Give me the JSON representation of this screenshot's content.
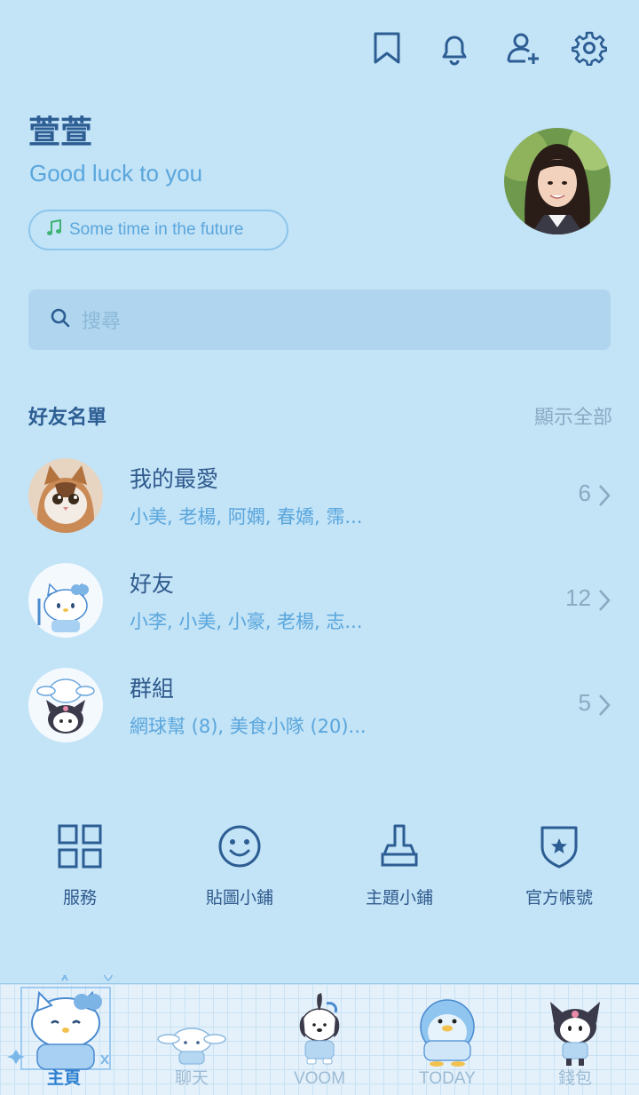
{
  "header": {
    "icons": [
      "bookmark-icon",
      "bell-icon",
      "add-friend-icon",
      "settings-gear-icon"
    ]
  },
  "profile": {
    "name": "萱萱",
    "status_message": "Good luck to you",
    "music": "Some time in the future"
  },
  "search": {
    "placeholder": "搜尋"
  },
  "friends_section": {
    "title": "好友名單",
    "show_all": "顯示全部",
    "groups": [
      {
        "title": "我的最愛",
        "subtitle": "小美, 老楊, 阿嫻, 春嬌, 霈...",
        "count": "6",
        "avatar": "cat"
      },
      {
        "title": "好友",
        "subtitle": "小李, 小美, 小豪, 老楊, 志...",
        "count": "12",
        "avatar": "kitty"
      },
      {
        "title": "群組",
        "subtitle": "網球幫 (8), 美食小隊 (20)...",
        "count": "5",
        "avatar": "group"
      }
    ]
  },
  "services": [
    {
      "label": "服務",
      "icon": "grid-icon"
    },
    {
      "label": "貼圖小鋪",
      "icon": "smiley-icon"
    },
    {
      "label": "主題小鋪",
      "icon": "brush-icon"
    },
    {
      "label": "官方帳號",
      "icon": "shield-star-icon"
    }
  ],
  "tabs": [
    {
      "label": "主頁",
      "active": true
    },
    {
      "label": "聊天",
      "active": false
    },
    {
      "label": "VOOM",
      "active": false
    },
    {
      "label": "TODAY",
      "active": false
    },
    {
      "label": "錢包",
      "active": false
    }
  ],
  "colors": {
    "background": "#c3e3f7",
    "primary_text": "#2c5d93",
    "accent_text": "#5aa6dc",
    "music_note": "#3cb371",
    "active_tab": "#2d7fd0"
  }
}
